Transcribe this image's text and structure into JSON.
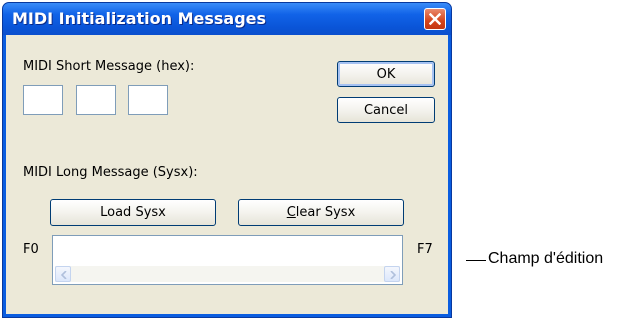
{
  "window": {
    "title": "MIDI Initialization Messages"
  },
  "short_message": {
    "label": "MIDI Short Message (hex):",
    "bytes": [
      "",
      "",
      ""
    ]
  },
  "buttons": {
    "ok_label": "OK",
    "cancel_label": "Cancel",
    "load_sysx_label": "Load Sysx",
    "clear_sysx_label_underlined": "C",
    "clear_sysx_label_rest": "lear Sysx"
  },
  "long_message": {
    "label": "MIDI Long Message (Sysx):",
    "prefix": "F0",
    "suffix": "F7",
    "value": ""
  },
  "annotation": {
    "edit_field": "Champ d'édition"
  },
  "icons": {
    "close": "close-icon",
    "scroll_left": "scroll-left-arrow-icon",
    "scroll_right": "scroll-right-arrow-icon"
  },
  "colors": {
    "titlebar": "#0a5de0",
    "client_bg": "#ece9d8",
    "close_button": "#d5441b",
    "field_border": "#7f9db9",
    "button_border": "#003c74"
  }
}
